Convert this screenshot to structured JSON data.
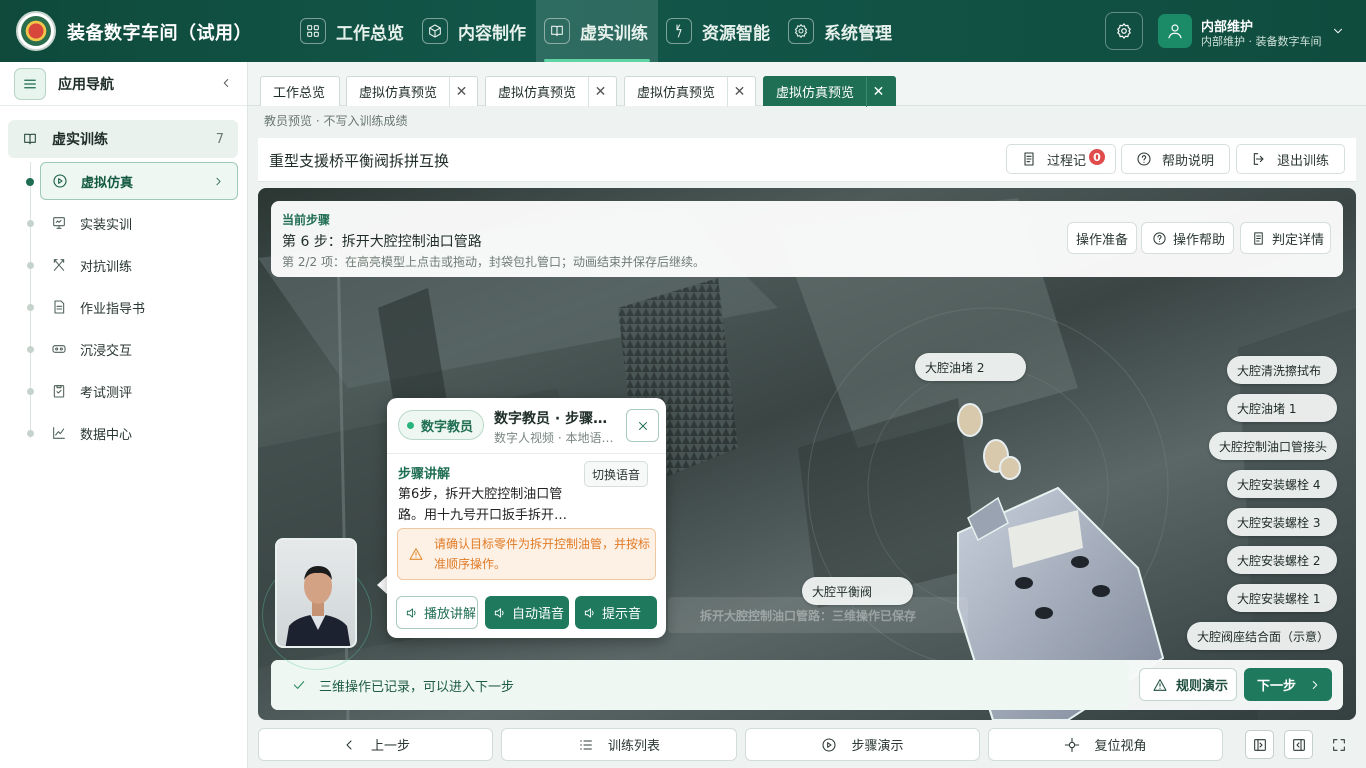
{
  "app": {
    "title": "装备数字车间（试用）"
  },
  "topnav": [
    {
      "label": "工作总览",
      "icon": "grid-icon"
    },
    {
      "label": "内容制作",
      "icon": "cube-icon"
    },
    {
      "label": "虚实训练",
      "icon": "book-icon",
      "active": true
    },
    {
      "label": "资源智能",
      "icon": "bolt-icon"
    },
    {
      "label": "系统管理",
      "icon": "gear-icon"
    }
  ],
  "user": {
    "name": "内部维护",
    "sub": "内部维护 · 装备数字车间"
  },
  "sidebar": {
    "title": "应用导航",
    "group": {
      "label": "虚实训练",
      "count": "7"
    },
    "items": [
      {
        "label": "虚拟仿真",
        "icon": "play-circle-icon",
        "active": true
      },
      {
        "label": "实装实训",
        "icon": "monitor-icon"
      },
      {
        "label": "对抗训练",
        "icon": "cross-swords-icon"
      },
      {
        "label": "作业指导书",
        "icon": "document-icon"
      },
      {
        "label": "沉浸交互",
        "icon": "vr-headset-icon"
      },
      {
        "label": "考试测评",
        "icon": "clipboard-check-icon"
      },
      {
        "label": "数据中心",
        "icon": "line-chart-icon"
      }
    ]
  },
  "tabs": [
    {
      "label": "工作总览",
      "closable": false
    },
    {
      "label": "虚拟仿真预览",
      "closable": true
    },
    {
      "label": "虚拟仿真预览",
      "closable": true
    },
    {
      "label": "虚拟仿真预览",
      "closable": true
    },
    {
      "label": "虚拟仿真预览",
      "closable": true,
      "active": true
    }
  ],
  "preview_note": "教员预览 · 不写入训练成绩",
  "header": {
    "title": "重型支援桥平衡阀拆拼互换",
    "record_label": "过程记",
    "record_badge": "0",
    "help_label": "帮助说明",
    "exit_label": "退出训练"
  },
  "step": {
    "kicker": "当前步骤",
    "title": "第 6 步：拆开大腔控制油口管路",
    "subtitle": "第 2/2 项：在高亮模型上点击或拖动，封袋包扎管口；动画结束并保存后继续。",
    "buttons": {
      "prep": "操作准备",
      "help": "操作帮助",
      "judge": "判定详情"
    }
  },
  "part_labels": [
    "大腔油堵 2",
    "大腔清洗擦拭布",
    "大腔油堵 1",
    "大腔控制油口管接头",
    "大腔安装螺栓 4",
    "大腔安装螺栓 3",
    "大腔安装螺栓 2",
    "大腔安装螺栓 1",
    "大腔阀座结合面（示意）",
    "大腔平衡阀"
  ],
  "ghost_status": "拆开大腔控制油口管路：三维操作已保存",
  "teacher": {
    "pill": "数字教员",
    "name": "数字教员 · 步骤讲解",
    "sub": "数字人视频 · 本地语音播报",
    "section": "步骤讲解",
    "switch_label": "切换语音",
    "body": "第6步，拆开大腔控制油口管路。用十九号开口扳手拆开…",
    "warning": "请确认目标零件为拆开控制油管，并按标准顺序操作。",
    "play": "播放讲解",
    "auto": "自动语音",
    "hint": "提示音"
  },
  "done": {
    "text": "三维操作已记录，可以进入下一步",
    "rule": "规则演示",
    "next": "下一步"
  },
  "footer": {
    "prev": "上一步",
    "list": "训练列表",
    "demo": "步骤演示",
    "reset": "复位视角"
  },
  "colors": {
    "brand": "#0f4a3b",
    "accent": "#1f7a5d",
    "warning": "#e07b26",
    "badge": "#e04b4b"
  }
}
